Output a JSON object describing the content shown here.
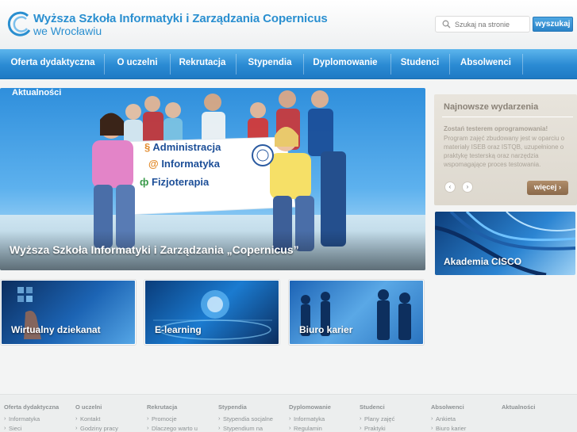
{
  "header": {
    "title": "Wyższa Szkoła Informatyki i Zarządzania Copernicus",
    "subtitle": "we Wrocławiu"
  },
  "search": {
    "placeholder": "Szukaj na stronie",
    "button_label": "wyszukaj"
  },
  "nav": {
    "items": [
      {
        "label": "Oferta dydaktyczna"
      },
      {
        "label": "O uczelni"
      },
      {
        "label": "Rekrutacja"
      },
      {
        "label": "Stypendia"
      },
      {
        "label": "Dyplomowanie"
      },
      {
        "label": "Studenci"
      },
      {
        "label": "Absolwenci"
      }
    ]
  },
  "hero": {
    "label": "Aktualności",
    "banner_lines": [
      "Administracja",
      "Informatyka",
      "Fizjoterapia"
    ],
    "banner_symbols": [
      "§",
      "@",
      "ф"
    ],
    "caption": "Wyższa Szkoła Informatyki i Zarządzania „Copernicus”"
  },
  "events": {
    "title": "Najnowsze wydarzenia",
    "headline": "Zostań testerem oprogramowania!",
    "body": "Program zajęć zbudowany jest w oparciu o materiały ISEB oraz ISTQB, uzupełnione o praktykę testerską oraz narzędzia wspomagające proces testowania.",
    "more_label": "więcej ›",
    "prev_icon": "‹",
    "next_icon": "›"
  },
  "cisco": {
    "label": "Akademia CISCO"
  },
  "tiles": [
    {
      "label": "Wirtualny dziekanat"
    },
    {
      "label": "E-learning"
    },
    {
      "label": "Biuro karier"
    }
  ],
  "footer": {
    "columns": [
      {
        "title": "Oferta dydaktyczna",
        "links": [
          "Informatyka",
          "Sieci"
        ]
      },
      {
        "title": "O uczelni",
        "links": [
          "Kontakt",
          "Godziny pracy"
        ]
      },
      {
        "title": "Rekrutacja",
        "links": [
          "Promocje",
          "Dlaczego warto u"
        ]
      },
      {
        "title": "Stypendia",
        "links": [
          "Stypendia socjalne",
          "Stypendium na"
        ]
      },
      {
        "title": "Dyplomowanie",
        "links": [
          "Informatyka",
          "Regulamin"
        ]
      },
      {
        "title": "Studenci",
        "links": [
          "Plany zajęć",
          "Praktyki"
        ]
      },
      {
        "title": "Absolwenci",
        "links": [
          "Ankieta",
          "Biuro karier"
        ]
      },
      {
        "title": "Aktualności",
        "links": []
      }
    ]
  },
  "colors": {
    "brand_blue": "#2a8fd0",
    "nav_blue": "#2a8ad3",
    "events_brown": "#8a6a4b"
  }
}
